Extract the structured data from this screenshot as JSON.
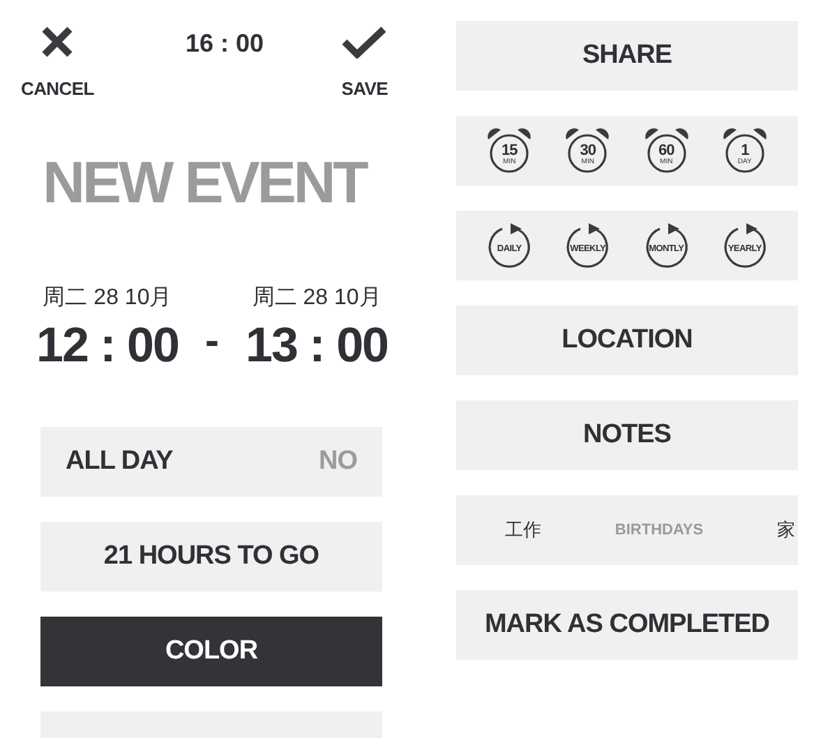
{
  "header": {
    "cancel": "CANCEL",
    "clock": "16 : 00",
    "save": "SAVE"
  },
  "title": "NEW EVENT",
  "start": {
    "date": "周二 28 10月",
    "time": "12 : 00"
  },
  "separator": "-",
  "end": {
    "date": "周二 28 10月",
    "time": "13 : 00"
  },
  "left_rows": [
    {
      "kind": "toggle",
      "label": "ALL DAY",
      "value": "NO"
    },
    {
      "kind": "plain",
      "label": "21 HOURS TO GO"
    },
    {
      "kind": "dark",
      "label": "COLOR"
    },
    {
      "kind": "blank"
    }
  ],
  "right_rows": [
    {
      "kind": "plain",
      "label": "SHARE"
    },
    {
      "kind": "reminders",
      "items": [
        {
          "value": "15",
          "unit": "MIN"
        },
        {
          "value": "30",
          "unit": "MIN"
        },
        {
          "value": "60",
          "unit": "MIN"
        },
        {
          "value": "1",
          "unit": "DAY"
        }
      ]
    },
    {
      "kind": "repeats",
      "items": [
        {
          "label": "DAILY"
        },
        {
          "label": "WEEKLY"
        },
        {
          "label": "MONTLY"
        },
        {
          "label": "YEARLY"
        }
      ]
    },
    {
      "kind": "plain",
      "label": "LOCATION"
    },
    {
      "kind": "plain",
      "label": "NOTES"
    },
    {
      "kind": "tags",
      "items": [
        {
          "label": "工作",
          "disabled": false
        },
        {
          "label": "BIRTHDAYS",
          "disabled": true
        },
        {
          "label": "家",
          "disabled": false
        }
      ]
    },
    {
      "kind": "plain",
      "label": "MARK AS COMPLETED"
    }
  ]
}
